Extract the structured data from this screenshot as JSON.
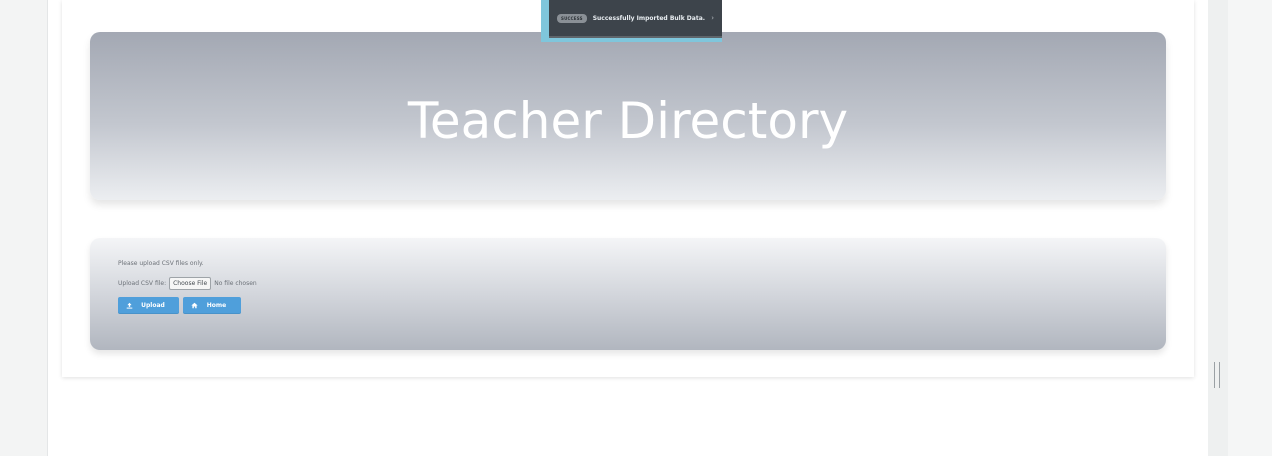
{
  "banner": {
    "title": "Teacher Directory"
  },
  "toast": {
    "badge": "SUCCESS",
    "message": "Successfully Imported Bulk Data.",
    "close_icon": "›"
  },
  "upload": {
    "hint": "Please upload CSV files only.",
    "file_label": "Upload CSV file:",
    "choose_file_label": "Choose File",
    "file_status": "No file chosen",
    "upload_button": "Upload",
    "home_button": "Home",
    "upload_icon": "upload-icon",
    "home_icon": "home-icon",
    "button_color": "#4f9fdb"
  }
}
